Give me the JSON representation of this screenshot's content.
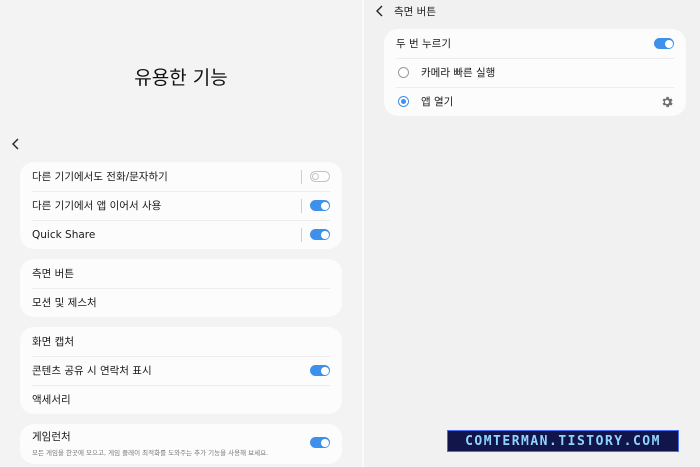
{
  "left": {
    "title": "유용한 기능",
    "groups": [
      {
        "items": [
          {
            "label": "다른 기기에서도 전화/문자하기",
            "toggle": "off"
          },
          {
            "label": "다른 기기에서 앱 이어서 사용",
            "toggle": "on"
          },
          {
            "label": "Quick Share",
            "toggle": "on"
          }
        ]
      },
      {
        "items": [
          {
            "label": "측면 버튼"
          },
          {
            "label": "모션 및 제스처"
          }
        ]
      },
      {
        "items": [
          {
            "label": "화면 캡처"
          },
          {
            "label": "콘텐츠 공유 시 연락처 표시",
            "toggle": "on"
          },
          {
            "label": "액세서리"
          }
        ]
      },
      {
        "items": [
          {
            "label": "게임런처",
            "description": "모든 게임을 한곳에 모으고, 게임 플레이 최적화를 도와주는 추가 기능을 사용해 보세요.",
            "toggle": "on"
          }
        ]
      }
    ]
  },
  "right": {
    "title": "측면 버튼",
    "double_press_label": "두 번 누르기",
    "double_press_toggle": "on",
    "options": [
      {
        "label": "카메라 빠른 실행",
        "selected": false
      },
      {
        "label": "앱 열기",
        "selected": true
      }
    ],
    "settings_icon": "gear-icon"
  },
  "watermark": "COMTERMAN.TISTORY.COM",
  "colors": {
    "accent": "#3e91ea",
    "background": "#f3f3f3",
    "card": "#fcfcfc"
  }
}
